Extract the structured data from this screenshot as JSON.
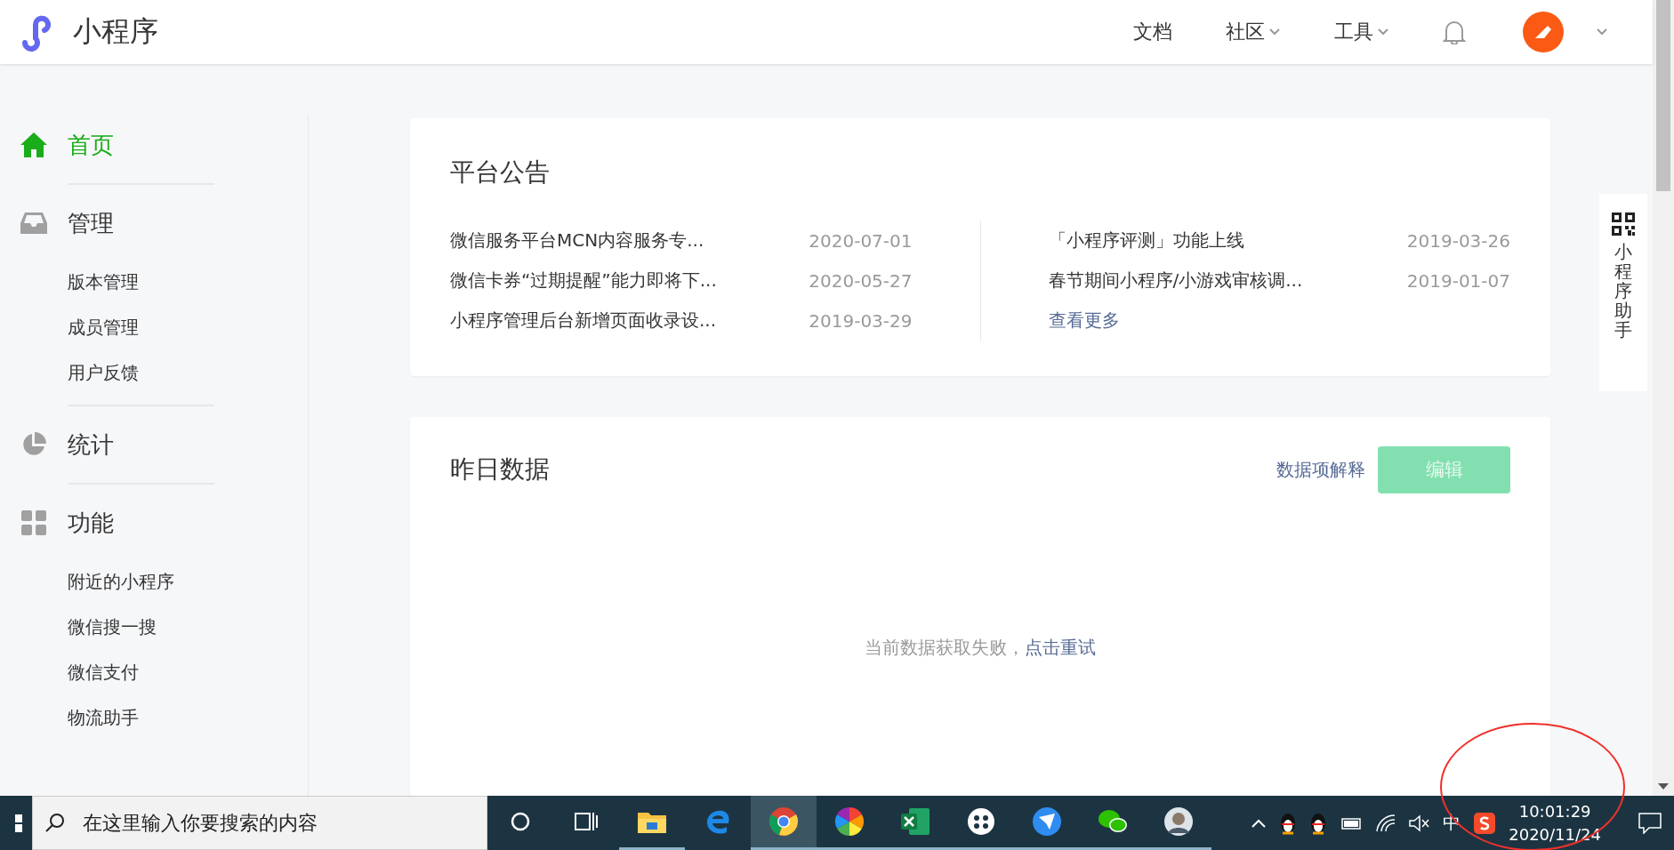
{
  "header": {
    "logo_text": "小程序",
    "nav": [
      {
        "label": "文档",
        "dropdown": false
      },
      {
        "label": "社区",
        "dropdown": true
      },
      {
        "label": "工具",
        "dropdown": true
      }
    ]
  },
  "sidebar": {
    "sections": [
      {
        "title": "首页",
        "selected": true
      },
      {
        "title": "管理",
        "selected": false,
        "children": [
          "版本管理",
          "成员管理",
          "用户反馈"
        ]
      },
      {
        "title": "统计",
        "selected": false
      },
      {
        "title": "功能",
        "selected": false,
        "children": [
          "附近的小程序",
          "微信搜一搜",
          "微信支付",
          "物流助手"
        ]
      }
    ]
  },
  "announcements": {
    "title": "平台公告",
    "left": [
      {
        "title": "微信服务平台MCN内容服务专...",
        "date": "2020-07-01"
      },
      {
        "title": "微信卡券“过期提醒”能力即将下...",
        "date": "2020-05-27"
      },
      {
        "title": "小程序管理后台新增页面收录设...",
        "date": "2019-03-29"
      }
    ],
    "right": [
      {
        "title": "「小程序评测」功能上线",
        "date": "2019-03-26"
      },
      {
        "title": "春节期间小程序/小游戏审核调...",
        "date": "2019-01-07"
      }
    ],
    "more_link": "查看更多"
  },
  "yesterday_data": {
    "title": "昨日数据",
    "explain_link": "数据项解释",
    "edit_button": {
      "label": "编辑",
      "disabled": true
    },
    "error_text": "当前数据获取失败，",
    "retry_link": "点击重试"
  },
  "assistant": {
    "label": "小程序助手"
  },
  "taskbar": {
    "search_placeholder": "在这里输入你要搜索的内容",
    "apps": [
      {
        "active": false,
        "running": false
      },
      {
        "active": false,
        "running": false
      },
      {
        "active": false,
        "running": true
      },
      {
        "active": false,
        "running": false
      },
      {
        "active": true,
        "running": true
      },
      {
        "active": false,
        "running": true
      },
      {
        "active": false,
        "running": true
      },
      {
        "active": false,
        "running": true
      },
      {
        "active": false,
        "running": true
      },
      {
        "active": false,
        "running": true
      },
      {
        "active": false,
        "running": true
      }
    ],
    "ime": "中",
    "time": "10:01:29",
    "date": "2020/11/24"
  }
}
